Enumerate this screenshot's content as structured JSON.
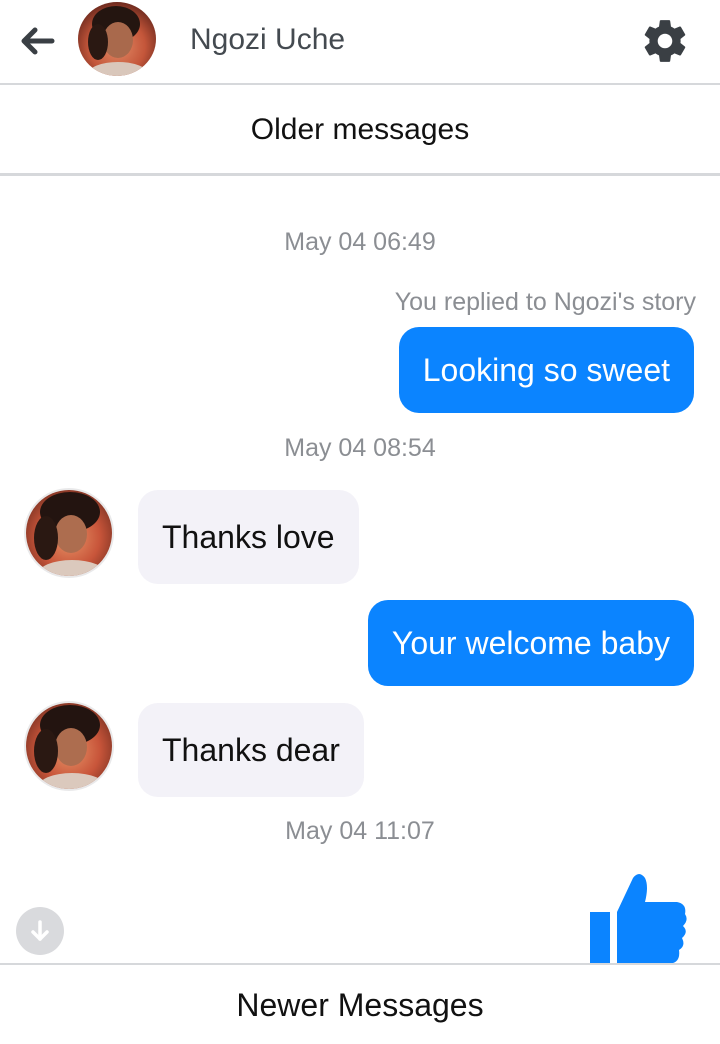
{
  "header": {
    "contact_name": "Ngozi Uche",
    "back_icon": "arrow-left-icon",
    "settings_icon": "gear-icon"
  },
  "older_messages_label": "Older messages",
  "messages": [
    {
      "type": "timestamp",
      "text": "May 04 06:49"
    },
    {
      "type": "story-note",
      "text": "You replied to Ngozi's story"
    },
    {
      "type": "outgoing",
      "text": "Looking so sweet"
    },
    {
      "type": "timestamp",
      "text": "May 04 08:54"
    },
    {
      "type": "incoming",
      "text": "Thanks love"
    },
    {
      "type": "outgoing",
      "text": "Your welcome baby"
    },
    {
      "type": "incoming",
      "text": "Thanks dear"
    },
    {
      "type": "timestamp",
      "text": "May 04 11:07"
    }
  ],
  "footer": {
    "scroll_down_icon": "arrow-down-icon",
    "like_icon": "thumbs-up-icon",
    "newer_messages_label": "Newer Messages"
  },
  "colors": {
    "outgoing_bubble": "#0b84ff",
    "incoming_bubble": "#f3f2f8",
    "like_icon": "#0b84ff",
    "timestamp_text": "#8b8e93",
    "divider": "#d6d8db"
  }
}
